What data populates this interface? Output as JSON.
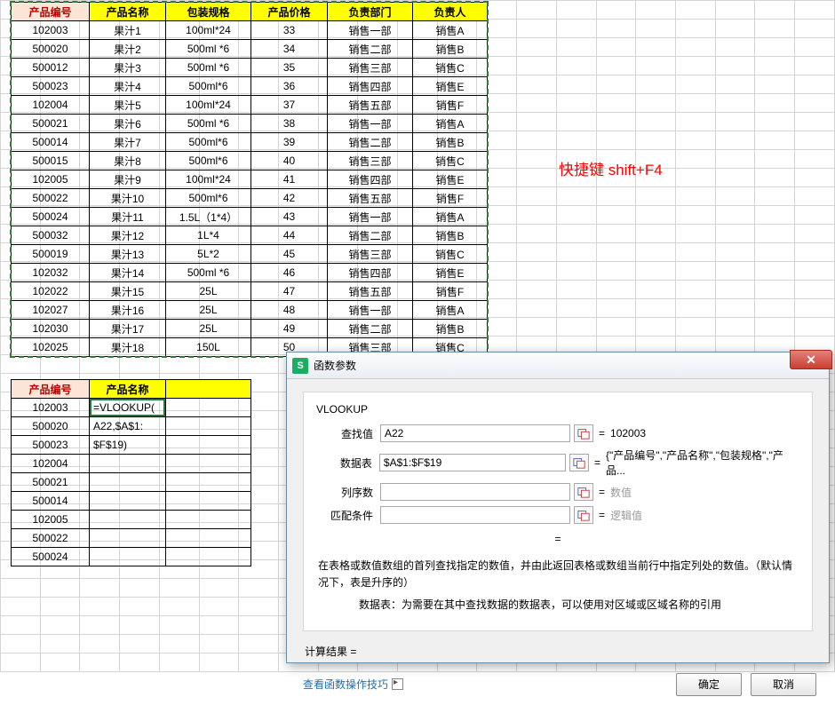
{
  "annotation": "快捷键 shift+F4",
  "table_headers": [
    "产品编号",
    "产品名称",
    "包装规格",
    "产品价格",
    "负责部门",
    "负责人"
  ],
  "table_rows": [
    [
      "102003",
      "果汁1",
      "100ml*24",
      "33",
      "销售一部",
      "销售A"
    ],
    [
      "500020",
      "果汁2",
      "500ml *6",
      "34",
      "销售二部",
      "销售B"
    ],
    [
      "500012",
      "果汁3",
      "500ml *6",
      "35",
      "销售三部",
      "销售C"
    ],
    [
      "500023",
      "果汁4",
      "500ml*6",
      "36",
      "销售四部",
      "销售E"
    ],
    [
      "102004",
      "果汁5",
      "100ml*24",
      "37",
      "销售五部",
      "销售F"
    ],
    [
      "500021",
      "果汁6",
      "500ml *6",
      "38",
      "销售一部",
      "销售A"
    ],
    [
      "500014",
      "果汁7",
      "500ml*6",
      "39",
      "销售二部",
      "销售B"
    ],
    [
      "500015",
      "果汁8",
      "500ml*6",
      "40",
      "销售三部",
      "销售C"
    ],
    [
      "102005",
      "果汁9",
      "100ml*24",
      "41",
      "销售四部",
      "销售E"
    ],
    [
      "500022",
      "果汁10",
      "500ml*6",
      "42",
      "销售五部",
      "销售F"
    ],
    [
      "500024",
      "果汁11",
      "1.5L（1*4）",
      "43",
      "销售一部",
      "销售A"
    ],
    [
      "500032",
      "果汁12",
      "1L*4",
      "44",
      "销售二部",
      "销售B"
    ],
    [
      "500019",
      "果汁13",
      "5L*2",
      "45",
      "销售三部",
      "销售C"
    ],
    [
      "102032",
      "果汁14",
      "500ml *6",
      "46",
      "销售四部",
      "销售E"
    ],
    [
      "102022",
      "果汁15",
      "25L",
      "47",
      "销售五部",
      "销售F"
    ],
    [
      "102027",
      "果汁16",
      "25L",
      "48",
      "销售一部",
      "销售A"
    ],
    [
      "102030",
      "果汁17",
      "25L",
      "49",
      "销售二部",
      "销售B"
    ],
    [
      "102025",
      "果汁18",
      "150L",
      "50",
      "销售三部",
      "销售C"
    ]
  ],
  "lower_headers": [
    "产品编号",
    "产品名称",
    ""
  ],
  "lower_rows": [
    [
      "102003",
      "=VLOOKUP(",
      ""
    ],
    [
      "500020",
      "A22,$A$1:",
      ""
    ],
    [
      "500023",
      "$F$19)",
      ""
    ],
    [
      "102004",
      "",
      ""
    ],
    [
      "500021",
      "",
      ""
    ],
    [
      "500014",
      "",
      ""
    ],
    [
      "102005",
      "",
      ""
    ],
    [
      "500022",
      "",
      ""
    ],
    [
      "500024",
      "",
      ""
    ]
  ],
  "dialog": {
    "title": "函数参数",
    "icon_letter": "S",
    "func_name": "VLOOKUP",
    "params": [
      {
        "label": "查找值",
        "value": "A22",
        "result": "102003",
        "gray": false
      },
      {
        "label": "数据表",
        "value": "$A$1:$F$19",
        "result": "{\"产品编号\",\"产品名称\",\"包装规格\",\"产品...",
        "gray": false
      },
      {
        "label": "列序数",
        "value": "",
        "result": "数值",
        "gray": true
      },
      {
        "label": "匹配条件",
        "value": "",
        "result": "逻辑值",
        "gray": true
      }
    ],
    "desc1": "在表格或数值数组的首列查找指定的数值，并由此返回表格或数组当前行中指定列处的数值。（默认情况下，表是升序的）",
    "desc2_label": "数据表：",
    "desc2_text": "为需要在其中查找数据的数据表，可以使用对区域或区域名称的引用",
    "calc_label": "计算结果 =",
    "help_text": "查看函数操作技巧",
    "ok": "确定",
    "cancel": "取消"
  }
}
